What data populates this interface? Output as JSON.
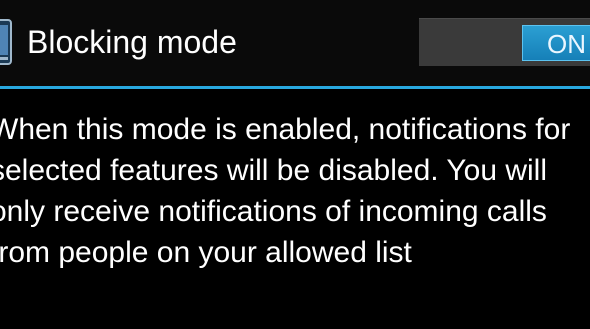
{
  "header": {
    "icon": "blocking-mode-icon",
    "title": "Blocking mode"
  },
  "toggle": {
    "state": "ON",
    "on": true
  },
  "description": {
    "text": "When this mode is enabled, notifications for selected features will be disabled. You will only receive notifications of incoming calls from people on your allowed list"
  },
  "colors": {
    "accent": "#29a9e0",
    "toggle_on": "#1e90c8",
    "background": "#000000",
    "text": "#ffffff"
  }
}
